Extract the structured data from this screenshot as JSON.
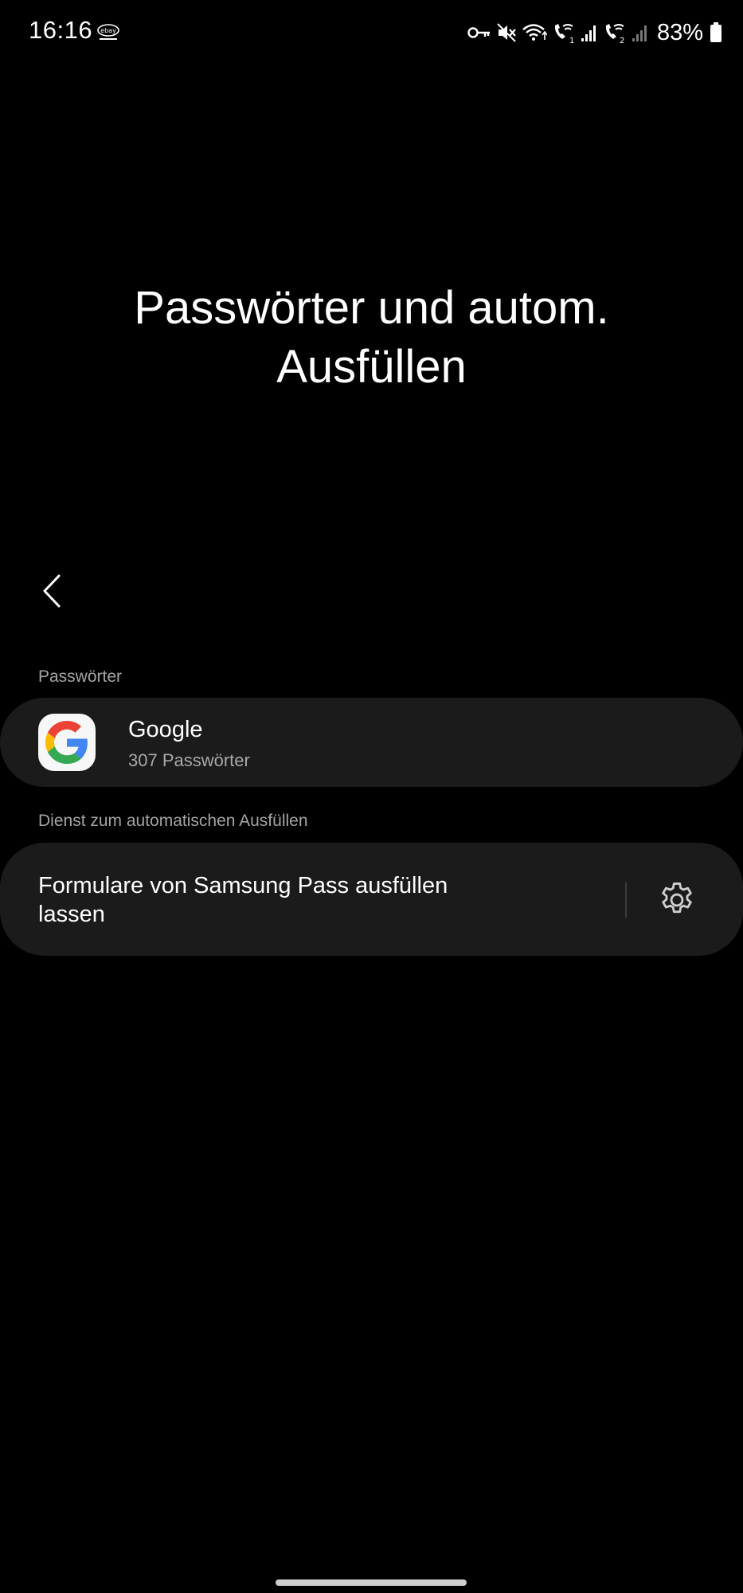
{
  "status_bar": {
    "time": "16:16",
    "battery": "83%",
    "icons": [
      "ebay-notification-icon",
      "vpn-key-icon",
      "mute-icon",
      "wifi-icon",
      "wifi-call-1-icon",
      "signal-1-icon",
      "wifi-call-2-icon",
      "signal-2-icon",
      "battery-icon"
    ]
  },
  "header": {
    "title": "Passwörter und autom.\nAusfüllen"
  },
  "sections": {
    "passwords": {
      "header": "Passwörter",
      "item": {
        "title": "Google",
        "subtitle": "307 Passwörter",
        "icon": "google-logo-icon"
      }
    },
    "autofill": {
      "header": "Dienst zum automatischen Ausfüllen",
      "item": {
        "label": "Formulare von Samsung Pass ausfüllen lassen",
        "action_icon": "gear-icon"
      }
    }
  },
  "colors": {
    "background": "#000000",
    "card": "#1b1b1b",
    "secondary_text": "#a4a4a4"
  }
}
